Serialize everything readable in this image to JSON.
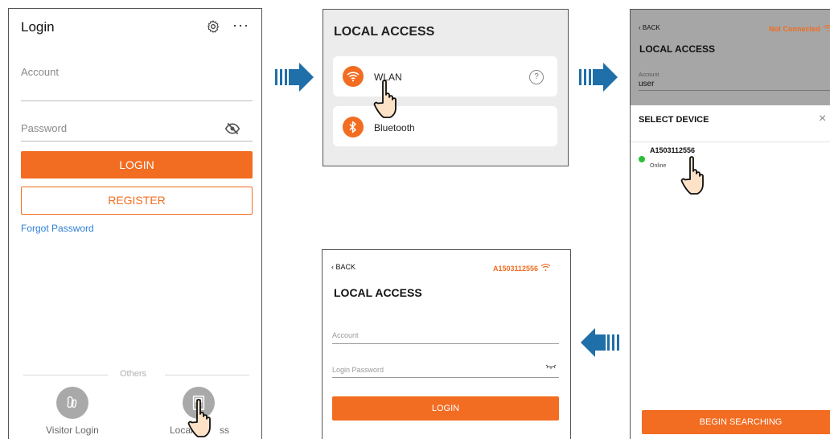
{
  "colors": {
    "accent": "#f26c21",
    "link": "#2e7fd6",
    "online": "#2bbf3a",
    "arrow": "#1f6fa8"
  },
  "screen1": {
    "title": "Login",
    "icons": [
      "gear-icon",
      "more-icon",
      "eye-slash-icon",
      "footprint-icon",
      "local-device-icon"
    ],
    "more_label": "···",
    "account_placeholder": "Account",
    "password_placeholder": "Password",
    "login_button": "LOGIN",
    "register_button": "REGISTER",
    "forgot_password": "Forgot Password",
    "others_label": "Others",
    "visitor_login": "Visitor Login",
    "local_access": "Local Access",
    "local_access_visible": "Local",
    "local_access_tail": "ss"
  },
  "screen2": {
    "title": "LOCAL ACCESS",
    "options": [
      {
        "label": "WLAN",
        "icon": "wifi-icon"
      },
      {
        "label": "Bluetooth",
        "icon": "bluetooth-icon"
      }
    ],
    "help_symbol": "?"
  },
  "screen3": {
    "back": "BACK",
    "connection_status": "Not Connected",
    "title": "LOCAL ACCESS",
    "account_label": "Account",
    "account_value": "user",
    "sheet_title": "SELECT DEVICE",
    "close_symbol": "×",
    "device_name": "A1503112556",
    "device_status": "Online",
    "search_button": "BEGIN SEARCHING"
  },
  "screen4": {
    "back": "BACK",
    "device_name": "A1503112556",
    "title": "LOCAL ACCESS",
    "account_placeholder": "Account",
    "password_placeholder": "Login Password",
    "login_button": "LOGIN"
  }
}
